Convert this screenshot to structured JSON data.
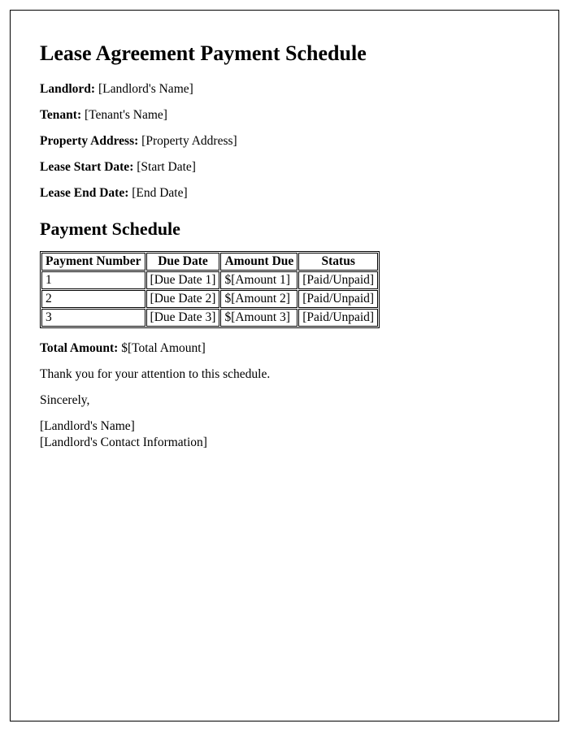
{
  "title": "Lease Agreement Payment Schedule",
  "fields": {
    "landlord_label": "Landlord:",
    "landlord_value": "[Landlord's Name]",
    "tenant_label": "Tenant:",
    "tenant_value": "[Tenant's Name]",
    "address_label": "Property Address:",
    "address_value": "[Property Address]",
    "start_label": "Lease Start Date:",
    "start_value": "[Start Date]",
    "end_label": "Lease End Date:",
    "end_value": "[End Date]"
  },
  "schedule_heading": "Payment Schedule",
  "table": {
    "headers": [
      "Payment Number",
      "Due Date",
      "Amount Due",
      "Status"
    ],
    "rows": [
      [
        "1",
        "[Due Date 1]",
        "$[Amount 1]",
        "[Paid/Unpaid]"
      ],
      [
        "2",
        "[Due Date 2]",
        "$[Amount 2]",
        "[Paid/Unpaid]"
      ],
      [
        "3",
        "[Due Date 3]",
        "$[Amount 3]",
        "[Paid/Unpaid]"
      ]
    ]
  },
  "total_label": "Total Amount:",
  "total_value": "$[Total Amount]",
  "thankyou": "Thank you for your attention to this schedule.",
  "signoff": "Sincerely,",
  "signature_name": "[Landlord's Name]",
  "signature_contact": "[Landlord's Contact Information]"
}
